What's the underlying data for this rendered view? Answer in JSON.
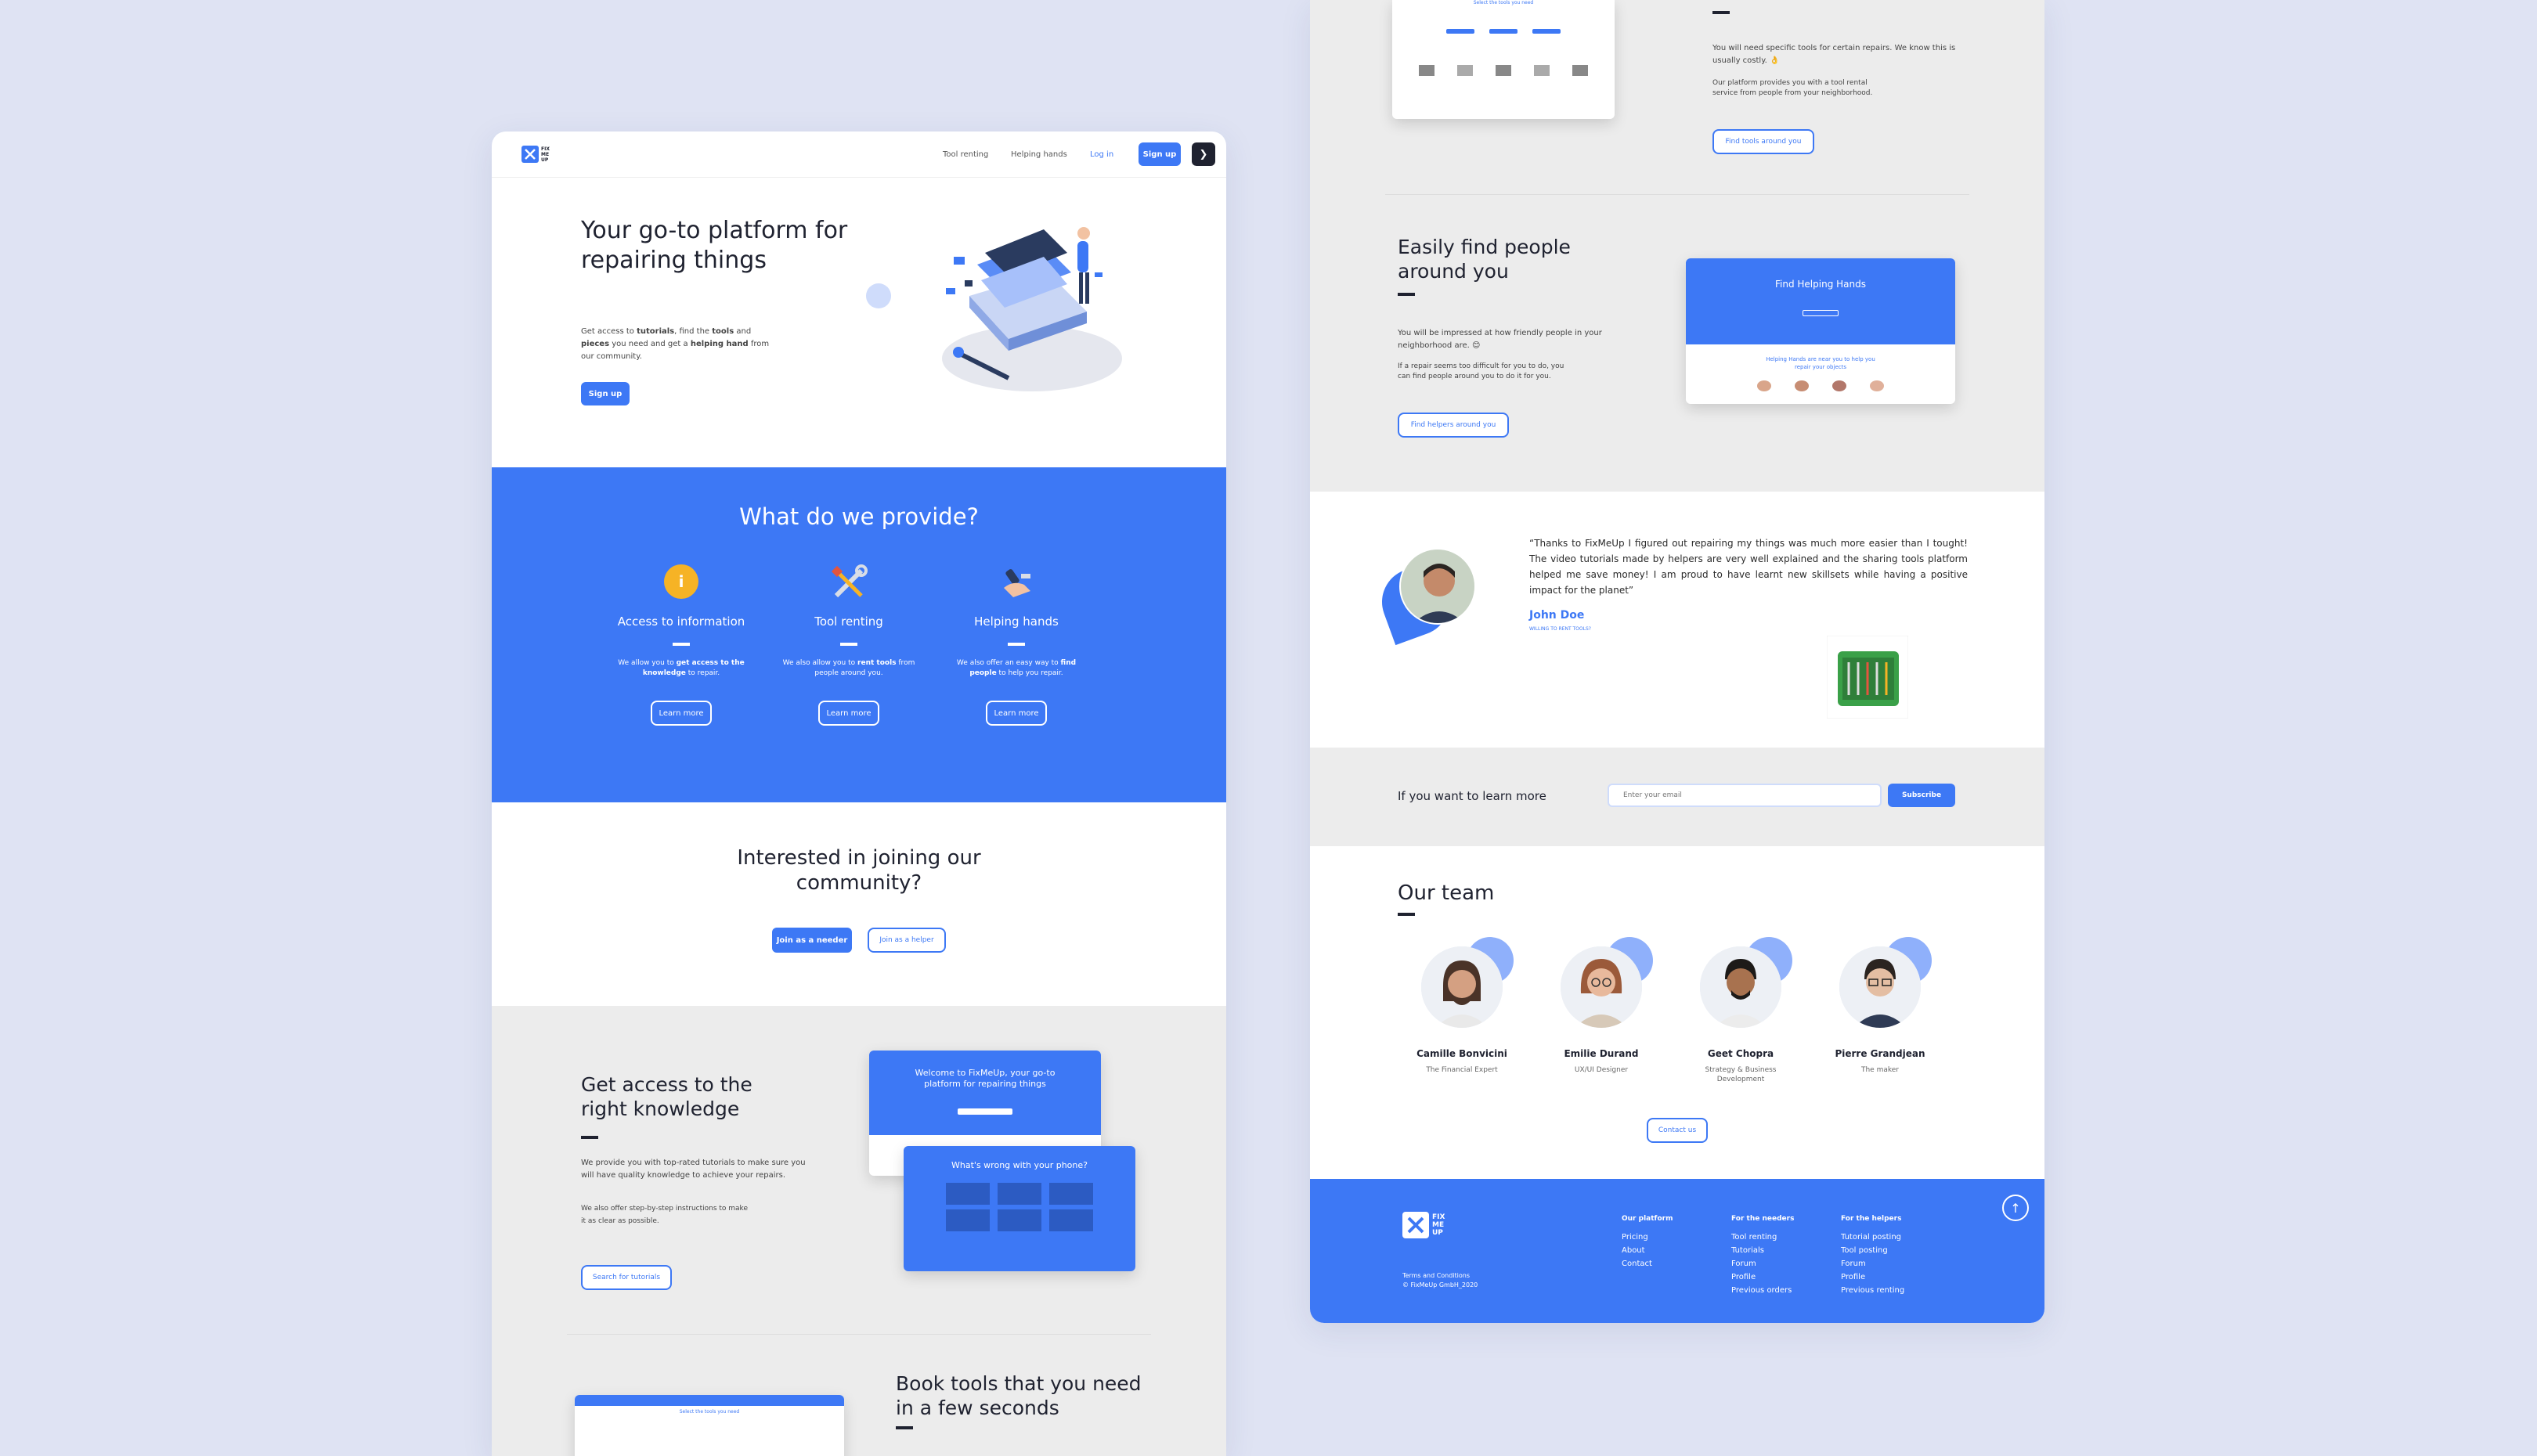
{
  "left": {
    "nav": {
      "links": [
        "Tool renting",
        "Helping hands",
        "Log in"
      ],
      "signup": "Sign up",
      "arrow": "❯",
      "logo_lines": [
        "FIX",
        "ME",
        "UP"
      ]
    },
    "hero": {
      "title": "Your go-to platform for repairing things",
      "desc": {
        "p1": "Get access to ",
        "b1": "tutorials",
        "p2": ", find the ",
        "b2": "tools",
        "p3": " and ",
        "b3": "pieces",
        "p4": " you need and get a ",
        "b4": "helping hand",
        "p5": " from our community."
      },
      "cta": "Sign up"
    },
    "provide": {
      "title": "What do we provide?",
      "items": [
        {
          "title": "Access to information",
          "pre": "We allow you to ",
          "bold": "get access to the knowledge",
          "post": " to repair.",
          "button": "Learn more"
        },
        {
          "title": "Tool renting",
          "pre": "We also allow you to ",
          "bold": "rent tools",
          "post": " from people around you.",
          "button": "Learn more"
        },
        {
          "title": "Helping hands",
          "pre": "We also offer an easy way to ",
          "bold": "find people",
          "post": " to help you repair.",
          "button": "Learn more"
        }
      ]
    },
    "community": {
      "title": "Interested in joining our community?",
      "needer": "Join as a needer",
      "helper": "Join as a helper"
    },
    "knowledge": {
      "title": "Get access to the right knowledge",
      "p1": "We provide you with top-rated tutorials to make sure you will have quality knowledge to achieve your repairs.",
      "p2": "We also offer step-by-step instructions to make it as clear as possible.",
      "button": "Search for tutorials",
      "screen1_title": "Welcome to FixMeUp, your go-to platform for repairing things",
      "screen2_title": "What's wrong with your phone?"
    },
    "book": {
      "title": "Book tools that you need in a few seconds",
      "screen_title": "Select the tools you need"
    }
  },
  "right": {
    "tools": {
      "p1": "You will need specific tools for certain repairs. We know this is usually costly. 👌",
      "p2": "Our platform provides you with a tool rental service from people from your neighborhood.",
      "button": "Find tools around you",
      "screen_title": "Select the tools you need"
    },
    "people": {
      "title": "Easily find people around you",
      "p1": "You will be impressed at how friendly people in your neighborhood are. 😊",
      "p2": "If a repair seems too difficult for you to do, you can find people around you to do it for you.",
      "button": "Find helpers around you",
      "screen_title": "Find Helping Hands",
      "screen_sub": "Helping Hands are near you to help you repair your objects"
    },
    "testimonial": {
      "quote": "“Thanks to FixMeUp I figured out repairing my things was much more easier than I tought! The video tutorials made by helpers are very well explained and the sharing tools platform helped me save money! I am proud to have learnt new skillsets while having a positive impact for the planet”",
      "name": "John Doe",
      "role": "WILLING TO RENT TOOLS?"
    },
    "newsletter": {
      "label": "If you want to learn more",
      "placeholder": "Enter your email",
      "button": "Subscribe"
    },
    "team": {
      "title": "Our team",
      "members": [
        {
          "name": "Camille Bonvicini",
          "role": "The Financial Expert"
        },
        {
          "name": "Emilie Durand",
          "role": "UX/UI Designer"
        },
        {
          "name": "Geet Chopra",
          "role": "Strategy & Business Development"
        },
        {
          "name": "Pierre Grandjean",
          "role": "The maker"
        }
      ],
      "contact": "Contact us"
    },
    "footer": {
      "logo_lines": [
        "FIX",
        "ME",
        "UP"
      ],
      "legal1": "Terms and Conditions",
      "legal2": "© FixMeUp GmbH_2020",
      "cols": [
        {
          "title": "Our platform",
          "items": [
            "Pricing",
            "About",
            "Contact"
          ]
        },
        {
          "title": "For the needers",
          "items": [
            "Tool renting",
            "Tutorials",
            "Forum",
            "Profile",
            "Previous orders"
          ]
        },
        {
          "title": "For the helpers",
          "items": [
            "Tutorial posting",
            "Tool posting",
            "Forum",
            "Profile",
            "Previous renting"
          ]
        }
      ],
      "up_icon": "↑"
    }
  },
  "colors": {
    "accent": "#3d78f5",
    "background": "#dfe3f3",
    "gray_section": "#ececec",
    "yellow_icon": "#f6b325"
  }
}
